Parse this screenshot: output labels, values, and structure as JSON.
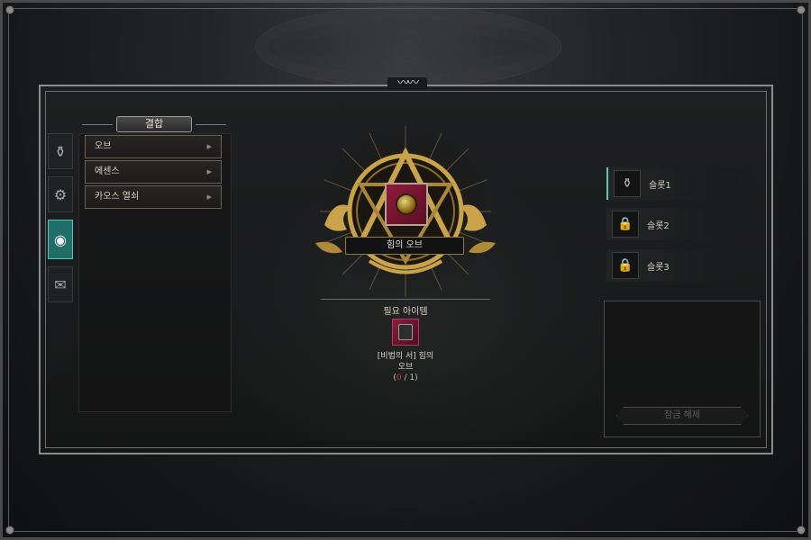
{
  "title": "결합",
  "categories": [
    {
      "label": "오브"
    },
    {
      "label": "에센스"
    },
    {
      "label": "카오스 열쇠"
    }
  ],
  "side_tabs": [
    {
      "icon": "flask-icon",
      "glyph": "⚱"
    },
    {
      "icon": "gear-icon",
      "glyph": "⚙"
    },
    {
      "icon": "orb-icon",
      "glyph": "◉"
    },
    {
      "icon": "scroll-icon",
      "glyph": "✉"
    }
  ],
  "target": {
    "name": "힘의 오브"
  },
  "required": {
    "label": "필요 아이템",
    "item_name_line1": "[비법의 서] 힘의",
    "item_name_line2": "오브",
    "count_have": "0",
    "count_sep": " / ",
    "count_need": "1"
  },
  "slots": [
    {
      "label": "슬롯1",
      "icon": "flask-icon",
      "glyph": "⚱",
      "locked": false
    },
    {
      "label": "슬롯2",
      "icon": "lock-icon",
      "glyph": "🔒",
      "locked": true
    },
    {
      "label": "슬롯3",
      "icon": "lock-icon",
      "glyph": "🔒",
      "locked": true
    }
  ],
  "unlock_button": "잠금 해제",
  "colors": {
    "accent_teal": "#1f6e67",
    "gold": "#c9a24a",
    "required_red": "#d23030",
    "item_crimson": "#8e1b3a"
  }
}
